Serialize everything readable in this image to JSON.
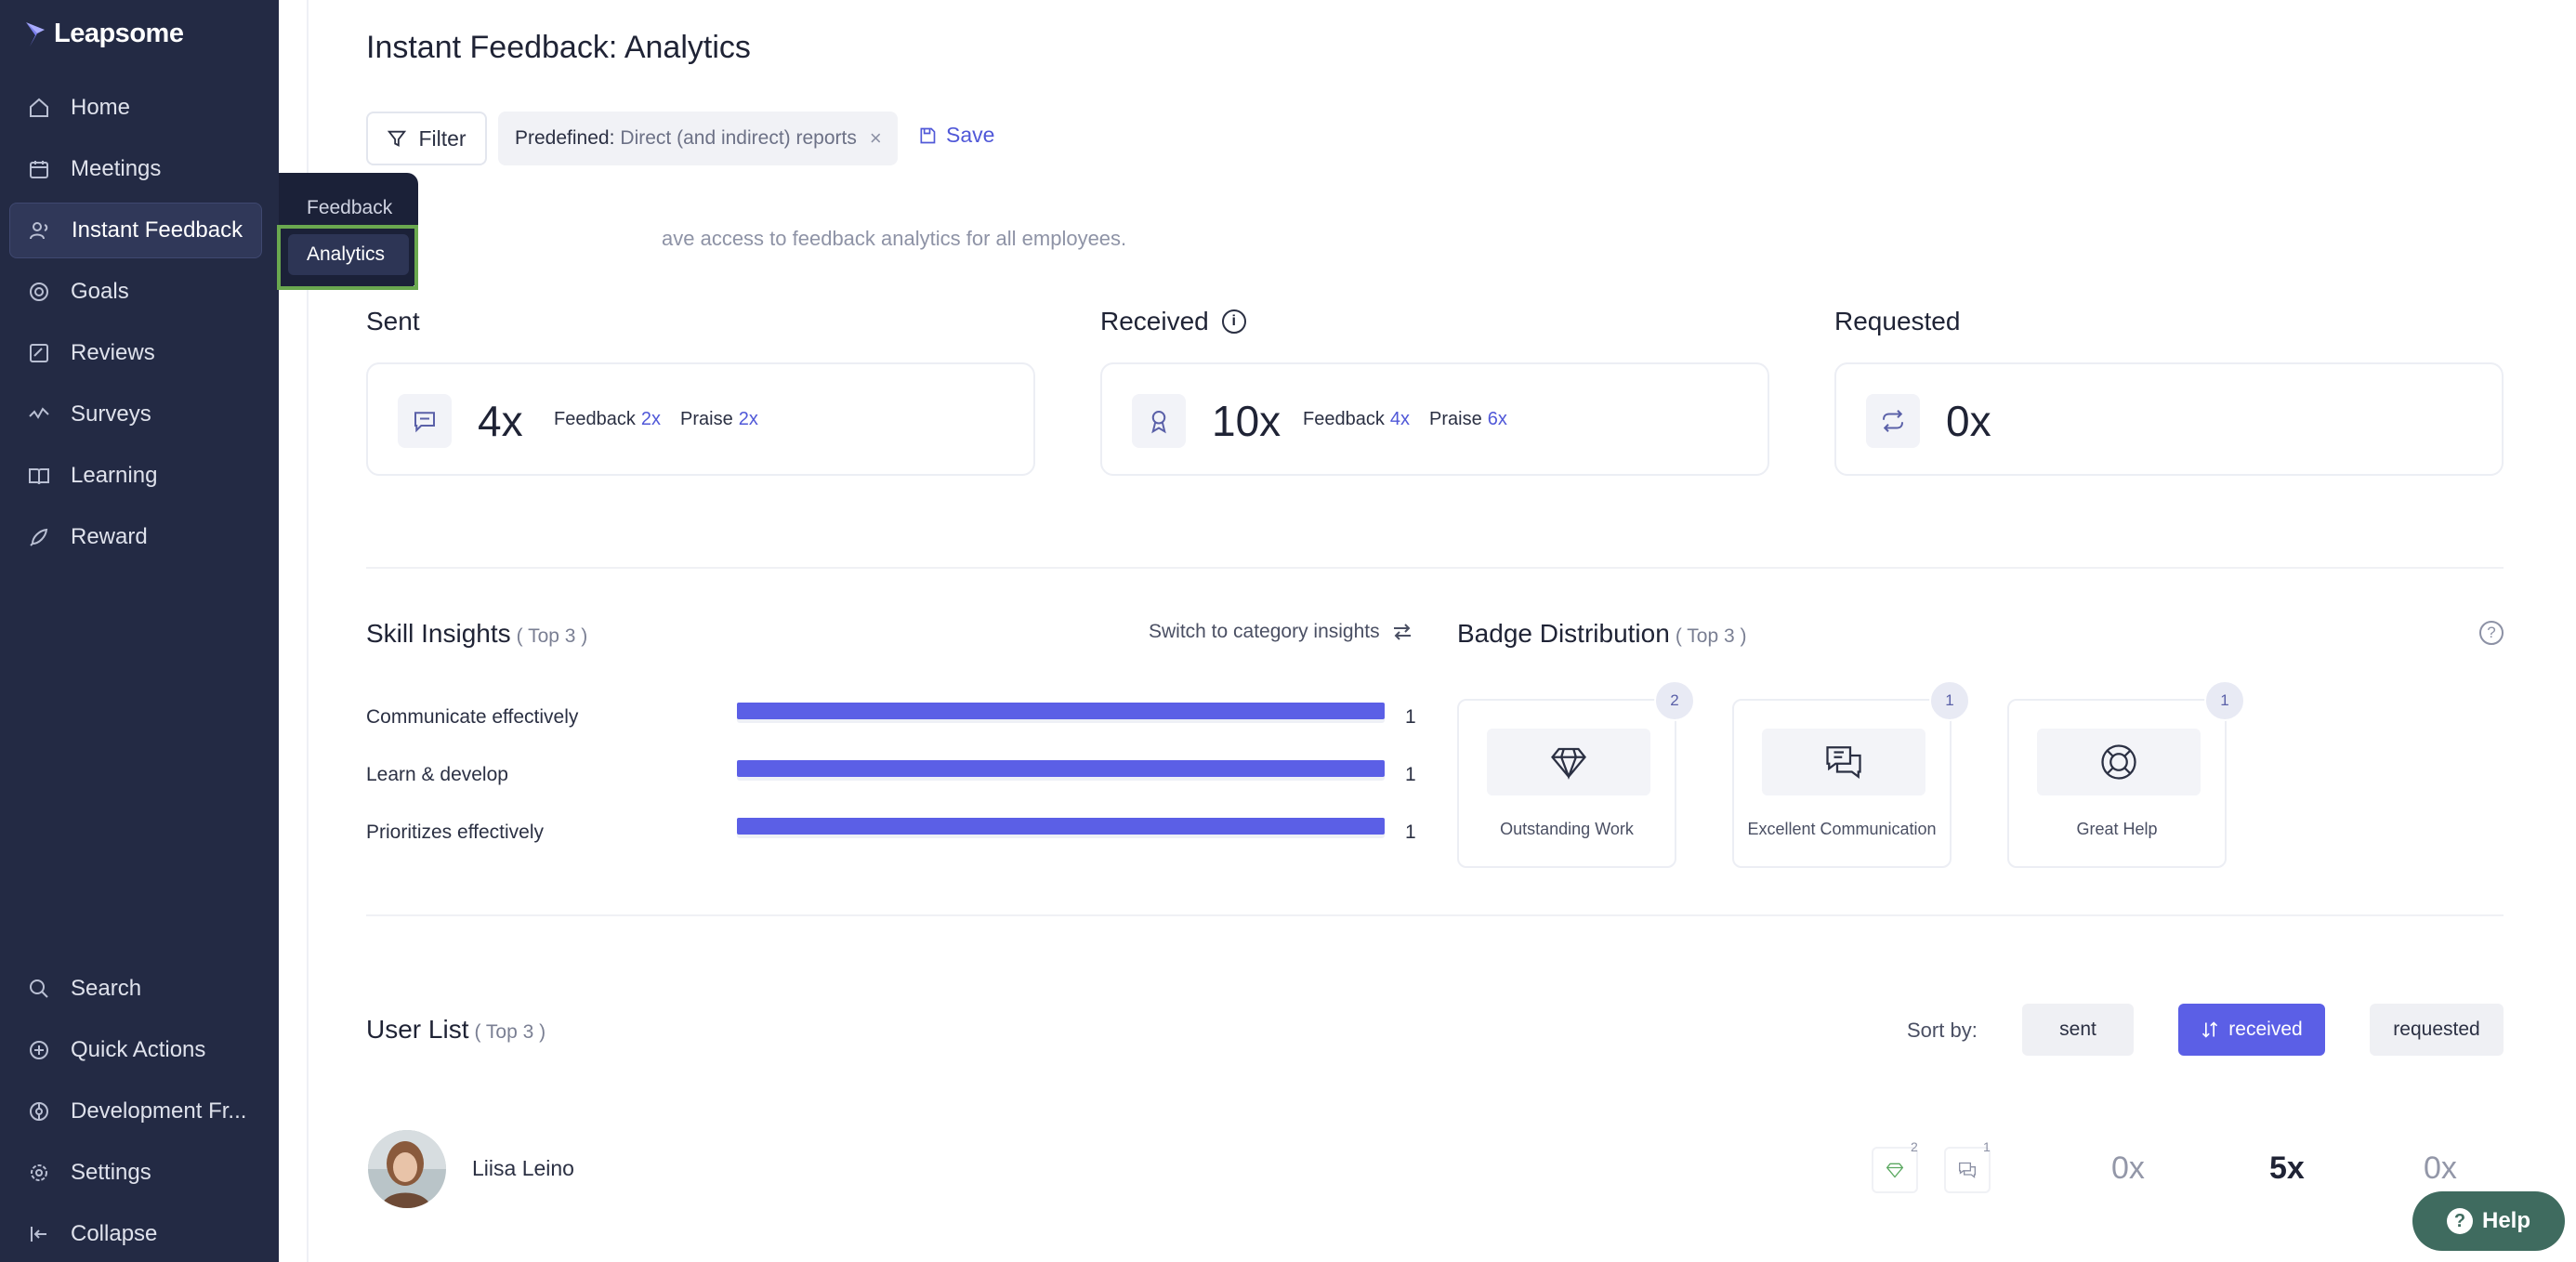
{
  "app": {
    "name": "Leapsome"
  },
  "sidebar": {
    "items": [
      {
        "label": "Home",
        "icon": "home-icon"
      },
      {
        "label": "Meetings",
        "icon": "meetings-icon"
      },
      {
        "label": "Instant Feedback",
        "icon": "feedback-icon",
        "active": true
      },
      {
        "label": "Goals",
        "icon": "goals-icon"
      },
      {
        "label": "Reviews",
        "icon": "reviews-icon"
      },
      {
        "label": "Surveys",
        "icon": "surveys-icon"
      },
      {
        "label": "Learning",
        "icon": "learning-icon"
      },
      {
        "label": "Reward",
        "icon": "reward-icon"
      }
    ],
    "bottom_items": [
      {
        "label": "Search",
        "icon": "search-icon"
      },
      {
        "label": "Quick Actions",
        "icon": "quick-actions-icon"
      },
      {
        "label": "Development Fr...",
        "icon": "development-icon"
      },
      {
        "label": "Settings",
        "icon": "gear-icon"
      },
      {
        "label": "Collapse",
        "icon": "collapse-icon"
      }
    ]
  },
  "flyout": {
    "items": [
      {
        "label": "Feedback"
      },
      {
        "label": "Analytics",
        "selected": true
      }
    ]
  },
  "header": {
    "title": "Instant Feedback: Analytics"
  },
  "filters": {
    "filter_label": "Filter",
    "chip_key": "Predefined:",
    "chip_value": "Direct (and indirect) reports",
    "chip_close": "×",
    "save_label": "Save"
  },
  "access_note": "ave access to feedback analytics for all employees.",
  "stats": {
    "sent": {
      "title": "Sent",
      "total": "4x",
      "feedback_label": "Feedback",
      "feedback": "2x",
      "praise_label": "Praise",
      "praise": "2x"
    },
    "received": {
      "title": "Received",
      "total": "10x",
      "feedback_label": "Feedback",
      "feedback": "4x",
      "praise_label": "Praise",
      "praise": "6x"
    },
    "requested": {
      "title": "Requested",
      "total": "0x"
    }
  },
  "skills": {
    "title": "Skill Insights",
    "top": "( Top 3 )",
    "switch_label": "Switch to category insights",
    "items": [
      {
        "label": "Communicate effectively",
        "value": "1",
        "fraction": 1.0
      },
      {
        "label": "Learn & develop",
        "value": "1",
        "fraction": 1.0
      },
      {
        "label": "Prioritizes effectively",
        "value": "1",
        "fraction": 1.0
      }
    ]
  },
  "badges": {
    "title": "Badge Distribution",
    "top": "( Top 3 )",
    "items": [
      {
        "name": "Outstanding Work",
        "count": "2",
        "icon": "diamond-icon"
      },
      {
        "name": "Excellent Communication",
        "count": "1",
        "icon": "chat-bubbles-icon"
      },
      {
        "name": "Great Help",
        "count": "1",
        "icon": "lifebuoy-icon"
      }
    ]
  },
  "users": {
    "title": "User List",
    "top": "( Top 3 )",
    "sort_by": "Sort by:",
    "sort_options": [
      "sent",
      "received",
      "requested"
    ],
    "sort_selected": "received",
    "rows": [
      {
        "name": "Liisa Leino",
        "badge1_count": "2",
        "badge2_count": "1",
        "sent": "0x",
        "received": "5x",
        "requested": "0x"
      }
    ]
  },
  "help": {
    "label": "Help"
  },
  "colors": {
    "sidebar": "#232a44",
    "accent": "#5b5fe6",
    "help": "#3f6b5f",
    "highlight": "#6aa84f"
  }
}
